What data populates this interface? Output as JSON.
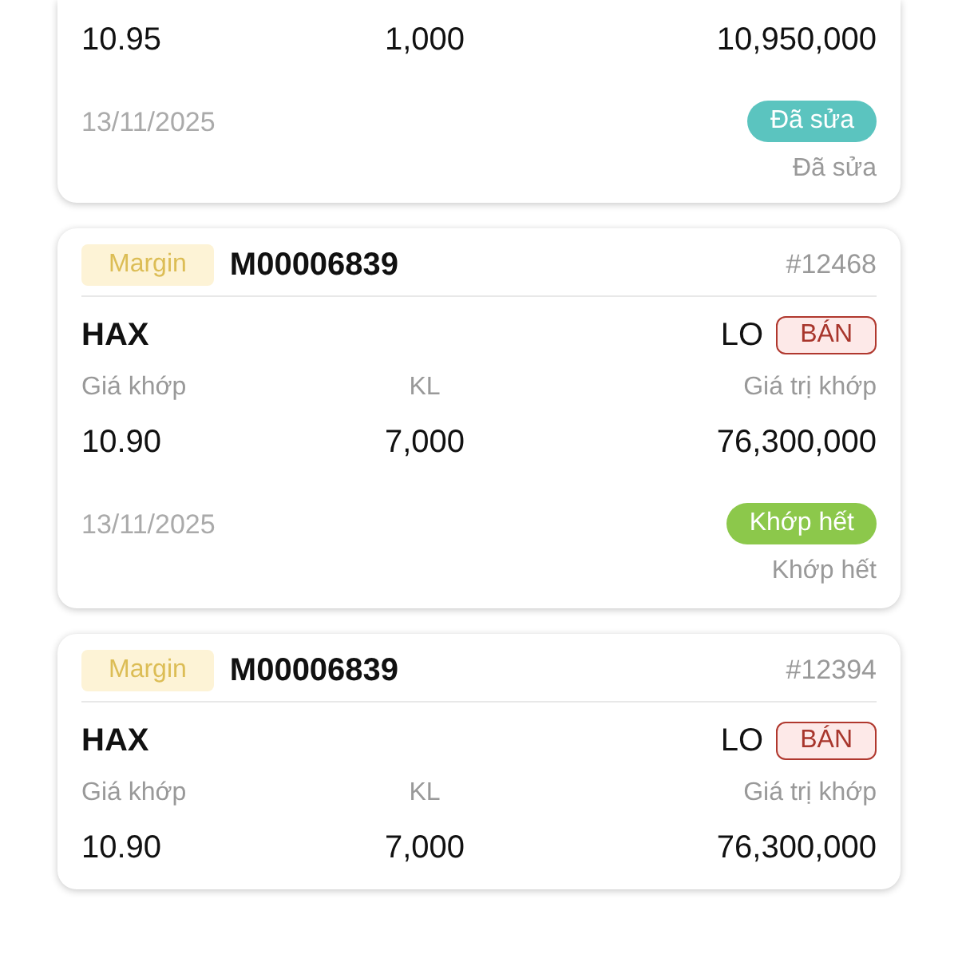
{
  "orders": [
    {
      "values": {
        "price": "10.95",
        "quantity": "1,000",
        "value": "10,950,000"
      },
      "date": "13/11/2025",
      "status_badge": {
        "label": "Đã sửa",
        "color": "#5bc4bf"
      },
      "status_text": "Đã sửa"
    },
    {
      "account_type": "Margin",
      "account": "M00006839",
      "order_no": "#12468",
      "symbol": "HAX",
      "order_type": "LO",
      "side": "BÁN",
      "labels": {
        "price": "Giá khớp",
        "quantity": "KL",
        "value": "Giá trị khớp"
      },
      "values": {
        "price": "10.90",
        "quantity": "7,000",
        "value": "76,300,000"
      },
      "date": "13/11/2025",
      "status_badge": {
        "label": "Khớp hết",
        "color": "#8cc84b"
      },
      "status_text": "Khớp hết"
    },
    {
      "account_type": "Margin",
      "account": "M00006839",
      "order_no": "#12394",
      "symbol": "HAX",
      "order_type": "LO",
      "side": "BÁN",
      "labels": {
        "price": "Giá khớp",
        "quantity": "KL",
        "value": "Giá trị khớp"
      },
      "values": {
        "price": "10.90",
        "quantity": "7,000",
        "value": "76,300,000"
      }
    }
  ]
}
